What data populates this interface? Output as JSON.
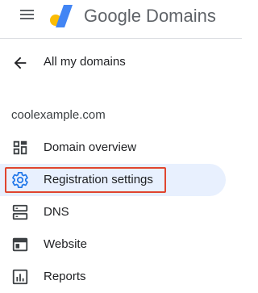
{
  "header": {
    "brand": "Google Domains",
    "menu_icon": "hamburger-menu-icon",
    "logo_icon": "google-domains-logo",
    "colors": {
      "logo_yellow": "#fbbc04",
      "logo_blue": "#4285f4"
    }
  },
  "back": {
    "label": "All my domains",
    "icon": "arrow-left-icon"
  },
  "domain": {
    "name": "coolexample.com"
  },
  "nav": {
    "items": [
      {
        "label": "Domain overview",
        "icon": "dashboard-icon",
        "active": false
      },
      {
        "label": "Registration settings",
        "icon": "gear-icon",
        "active": true
      },
      {
        "label": "DNS",
        "icon": "dns-icon",
        "active": false
      },
      {
        "label": "Website",
        "icon": "website-icon",
        "active": false
      },
      {
        "label": "Reports",
        "icon": "reports-icon",
        "active": false
      }
    ]
  },
  "colors": {
    "active_bg": "#e8f0fe",
    "active_icon": "#1a73e8",
    "highlight_border": "#e0452f"
  }
}
